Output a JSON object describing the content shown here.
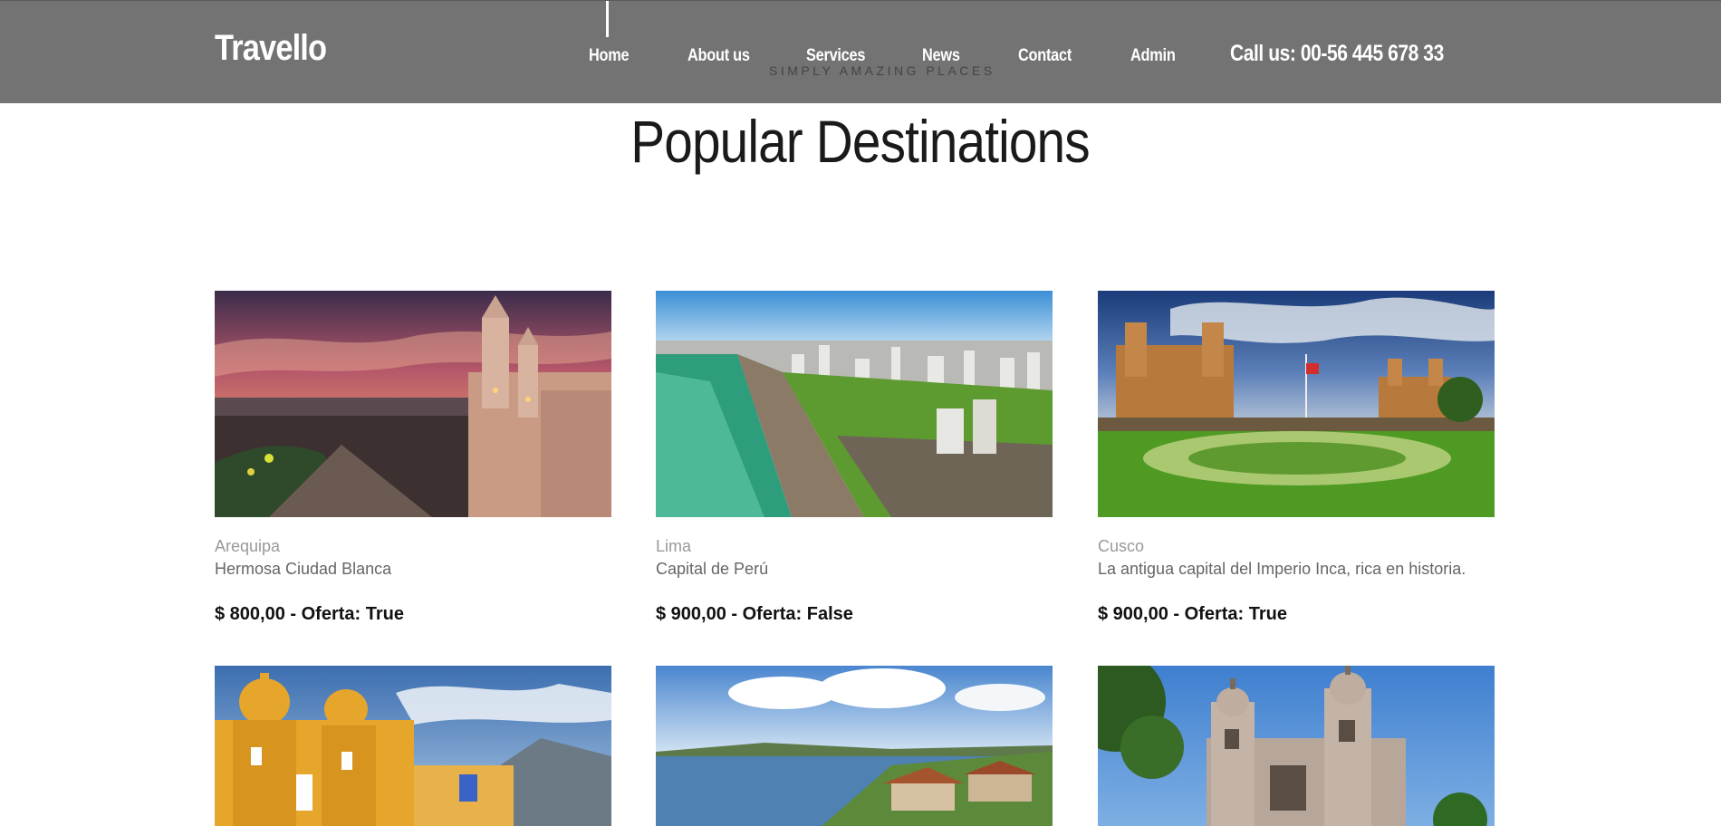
{
  "header": {
    "logo": "Travello",
    "nav": [
      "Home",
      "About us",
      "Services",
      "News",
      "Contact",
      "Admin"
    ],
    "call": "Call us: 00-56 445 678 33",
    "tagline": "SIMPLY AMAZING PLACES"
  },
  "main": {
    "title": "Popular Destinations",
    "destinations": [
      {
        "city": "Arequipa",
        "description": "Hermosa Ciudad Blanca",
        "price": "$ 800,00 - Oferta: True",
        "image": "arequipa-cathedral-sunset"
      },
      {
        "city": "Lima",
        "description": "Capital de Perú",
        "price": "$ 900,00 - Oferta: False",
        "image": "lima-coast-aerial"
      },
      {
        "city": "Cusco",
        "description": "La antigua capital del Imperio Inca, rica en historia.",
        "price": "$ 900,00 - Oferta: True",
        "image": "cusco-plaza-cathedral"
      },
      {
        "image": "trujillo-yellow-cathedral"
      },
      {
        "image": "lake-titicaca-view"
      },
      {
        "image": "colonial-cathedral-towers"
      }
    ]
  },
  "colors": {
    "header_bg": "#737373",
    "title_text": "#1a1a1a",
    "city_text": "#999999",
    "desc_text": "#666666"
  }
}
